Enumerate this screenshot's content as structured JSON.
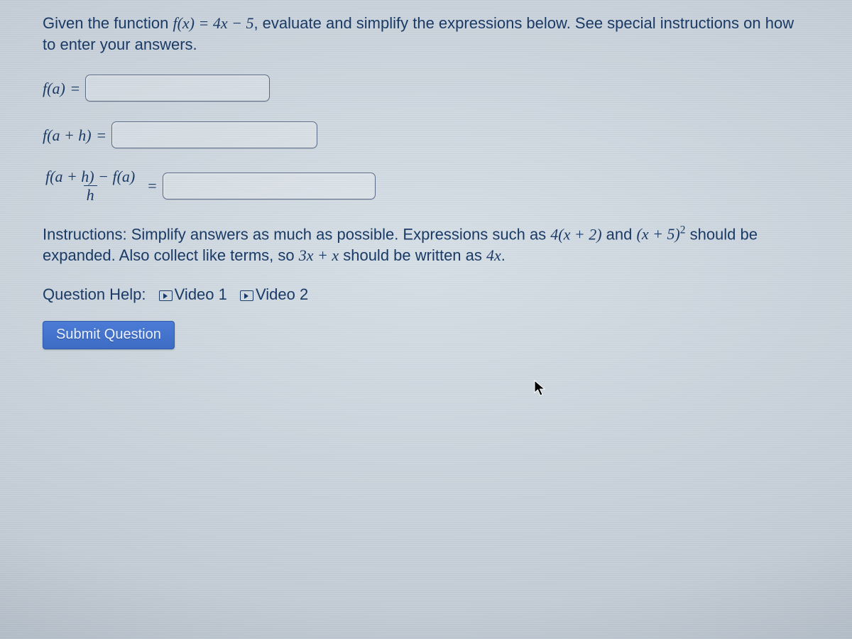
{
  "prompt": {
    "lead": "Given the function ",
    "func": "f(x) = 4x − 5",
    "tail": ", evaluate and simplify the expressions below. See special instructions on how to enter your answers."
  },
  "rows": {
    "r1_lhs": "f(a)",
    "r2_lhs": "f(a + h)",
    "r3_num": "f(a + h) − f(a)",
    "r3_den": "h",
    "equals": "="
  },
  "inputs": {
    "fa_value": "",
    "fah_value": "",
    "diff_value": ""
  },
  "instructions": {
    "lead": "Instructions: Simplify answers as much as possible. Expressions such as ",
    "expr1": "4(x + 2)",
    "mid1": " and ",
    "expr2_base": "(x + 5)",
    "expr2_exp": "2",
    "mid2": " should be expanded. Also collect like terms, so ",
    "expr3": "3x + x",
    "mid3": " should be written as ",
    "expr4": "4x",
    "end": "."
  },
  "help": {
    "label": "Question Help:",
    "video1": "Video 1",
    "video2": "Video 2"
  },
  "submit_label": "Submit Question"
}
